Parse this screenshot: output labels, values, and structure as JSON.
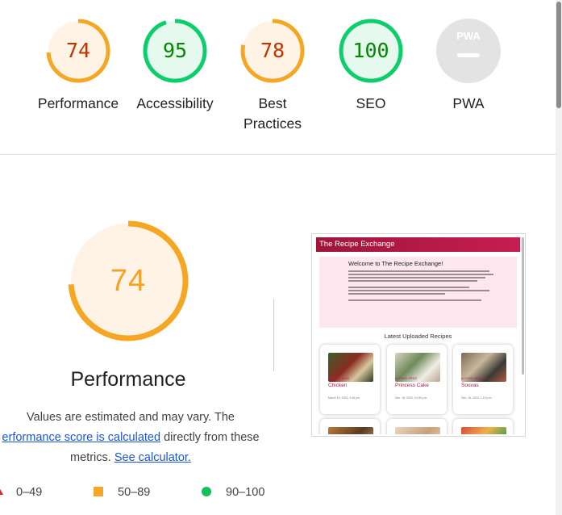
{
  "top_gauges": [
    {
      "score": "74",
      "label": "Performance",
      "status": "average",
      "fraction": 0.74
    },
    {
      "score": "95",
      "label": "Accessibility",
      "status": "pass",
      "fraction": 0.95
    },
    {
      "score": "78",
      "label": "Best Practices",
      "status": "average",
      "fraction": 0.78
    },
    {
      "score": "100",
      "label": "SEO",
      "status": "pass",
      "fraction": 1.0
    },
    {
      "score": "PWA",
      "label": "PWA",
      "status": "na",
      "fraction": 0
    }
  ],
  "colors": {
    "average_ring": "#f5a623",
    "average_fill": "#fff3e6",
    "average_text": "#c33300",
    "pass_ring": "#0cce6b",
    "pass_fill": "#e5f9ee",
    "pass_text": "#008800",
    "na_fill": "#e3e3e3",
    "fail": "#e6222d",
    "link": "#1a56d6"
  },
  "main": {
    "score": "74",
    "fraction": 0.74,
    "title": "Performance",
    "estimate_prefix": "Values are estimated and may vary. The",
    "link_score": "erformance score is calculated",
    "estimate_middle": "directly from these",
    "estimate_tail": "metrics.",
    "link_calculator": "See calculator."
  },
  "legend": [
    {
      "range": "0–49",
      "shape": "triangle"
    },
    {
      "range": "50–89",
      "shape": "square"
    },
    {
      "range": "90–100",
      "shape": "circle"
    }
  ],
  "screenshot": {
    "site_title": "The Recipe Exchange",
    "welcome_heading": "Welcome to The Recipe Exchange!",
    "latest_heading": "Latest Uploaded Recipes",
    "cards": [
      {
        "name": "Chicken",
        "tag": "AUTHOR: DEBS",
        "date": "March 15, 2024, 3:45 pm"
      },
      {
        "name": "Princess Cake",
        "tag": "AUTHOR: PRICE",
        "date": "Dec. 18, 2023, 10:05 p.m."
      },
      {
        "name": "Souvas",
        "tag": "AUTHOR: BROCK",
        "date": "Dec. 16, 2023, 1:15 p.m."
      }
    ]
  }
}
